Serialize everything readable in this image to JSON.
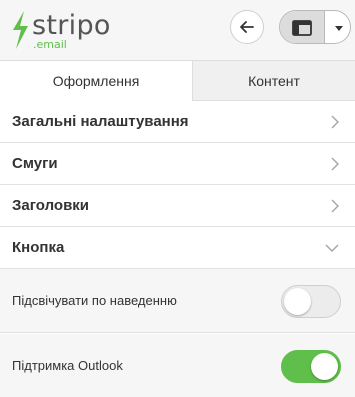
{
  "brand": {
    "name": "stripo",
    "sub": ".email",
    "green": "#5fbf4a"
  },
  "header": {
    "back_icon": "arrow-left-icon",
    "view_icon": "layout-panel-icon",
    "dropdown_icon": "caret-down-icon"
  },
  "tabs": [
    {
      "label": "Оформлення",
      "active": true
    },
    {
      "label": "Контент",
      "active": false
    }
  ],
  "sections": [
    {
      "label": "Загальні налаштування",
      "state": "collapsed"
    },
    {
      "label": "Смуги",
      "state": "collapsed"
    },
    {
      "label": "Заголовки",
      "state": "collapsed"
    },
    {
      "label": "Кнопка",
      "state": "expanded"
    }
  ],
  "options": [
    {
      "label": "Підсвічувати по наведенню",
      "enabled": false
    },
    {
      "label": "Підтримка Outlook",
      "enabled": true
    }
  ]
}
